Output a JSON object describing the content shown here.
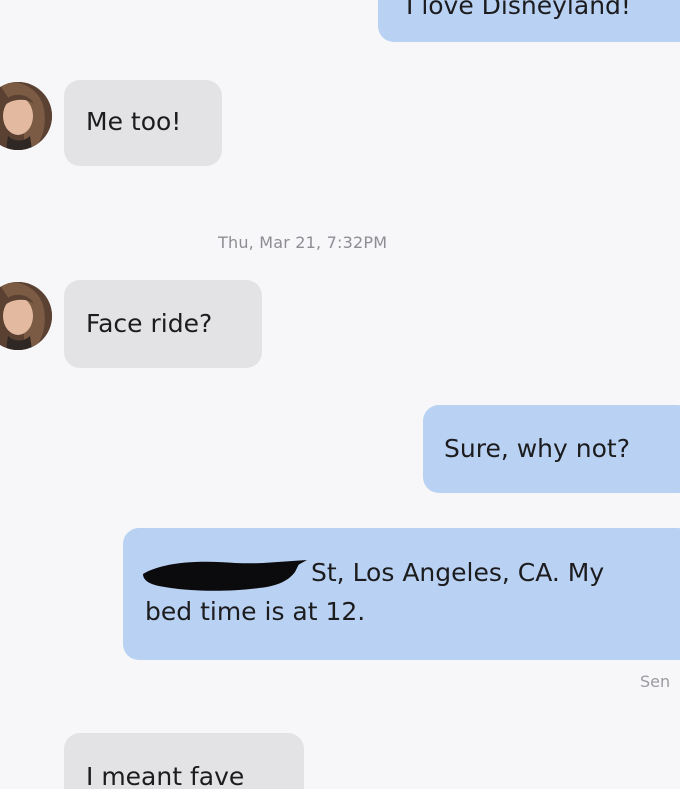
{
  "messages": {
    "m1": {
      "text": "I love Disneyland!"
    },
    "m2": {
      "text": "Me too!"
    },
    "timestamp": "Thu, Mar 21, 7:32PM",
    "m3": {
      "text": "Face ride?"
    },
    "m4": {
      "text": "Sure, why not?"
    },
    "m5": {
      "line1": "St, Los Angeles, CA. My",
      "line2": "bed time is at 12."
    },
    "status": "Sen",
    "m6": {
      "text": "I meant fave"
    }
  },
  "colors": {
    "incoming_bubble": "#e3e3e6",
    "outgoing_bubble": "#b9d2f3",
    "background": "#f7f7f9"
  }
}
